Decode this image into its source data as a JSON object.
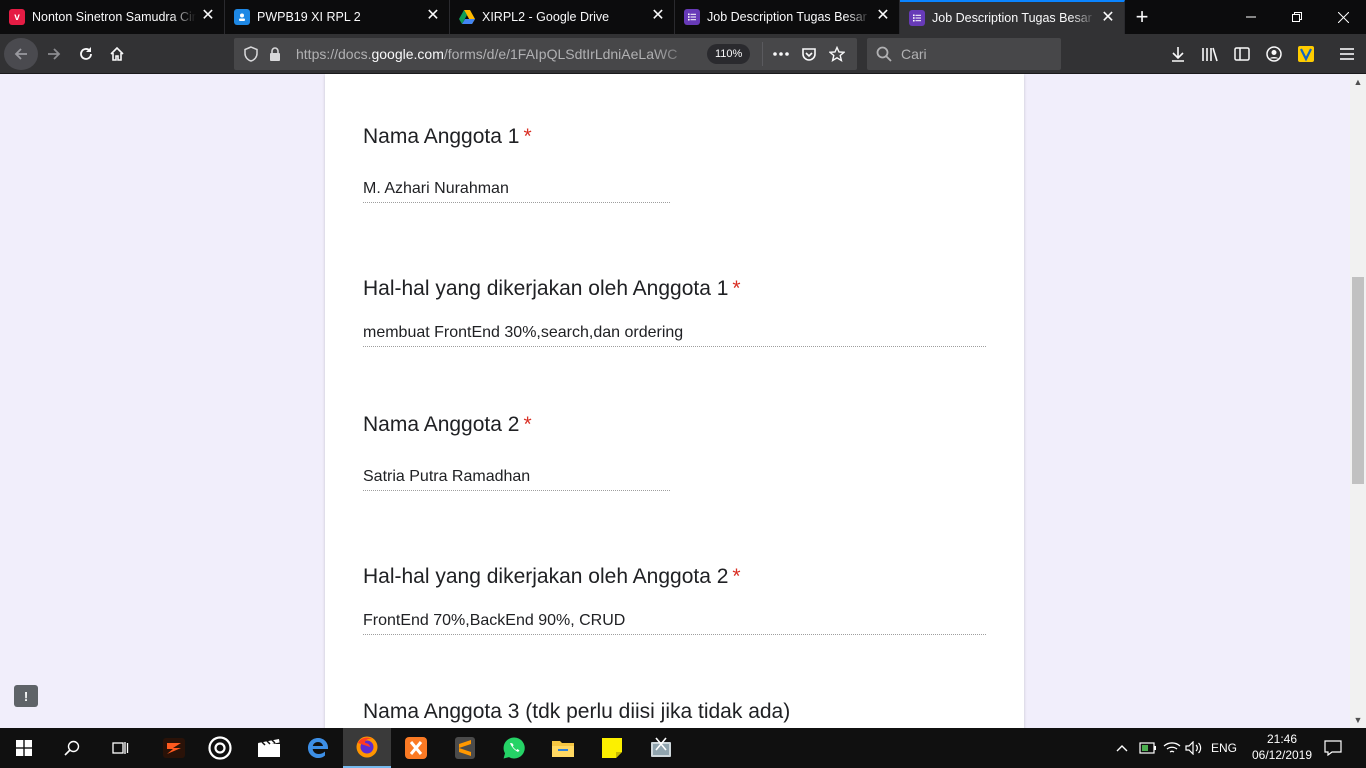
{
  "browser": {
    "tabs": [
      {
        "title": "Nonton Sinetron Samudra Cinta",
        "icon": "vidio-icon",
        "color": "#e51c44"
      },
      {
        "title": "PWPB19 XI RPL 2",
        "icon": "google-classroom-icon",
        "color": "#1e88e5"
      },
      {
        "title": "XIRPL2 - Google Drive",
        "icon": "google-drive-icon",
        "color": "#0f9d58"
      },
      {
        "title": "Job Description Tugas Besar ga",
        "icon": "google-forms-icon",
        "color": "#673ab7"
      },
      {
        "title": "Job Description Tugas Besar ga",
        "icon": "google-forms-icon",
        "color": "#673ab7"
      }
    ],
    "active_tab_index": 4,
    "url_prefix": "https://docs.",
    "url_domain": "google.com",
    "url_suffix": "/forms/d/e/1FAIpQLSdtIrLdniAeLaWC",
    "zoom": "110%",
    "search_placeholder": "Cari"
  },
  "form": {
    "questions": [
      {
        "title": "Nama Anggota 1",
        "required": "*",
        "answer": "M. Azhari Nurahman"
      },
      {
        "title": "Hal-hal yang dikerjakan oleh Anggota 1",
        "required": "*",
        "answer": "membuat FrontEnd 30%,search,dan ordering"
      },
      {
        "title": "Nama Anggota 2",
        "required": "*",
        "answer": "Satria Putra Ramadhan"
      },
      {
        "title": "Hal-hal yang dikerjakan oleh Anggota 2",
        "required": "*",
        "answer": "FrontEnd 70%,BackEnd 90%, CRUD"
      },
      {
        "title": "Nama Anggota 3 (tdk perlu diisi jika tidak ada)"
      }
    ],
    "feedback_icon": "!"
  },
  "taskbar": {
    "apps": [
      "start-icon",
      "search-icon",
      "task-view-icon",
      "game-app-icon",
      "media-icon",
      "movies-icon",
      "edge-icon",
      "firefox-icon",
      "xampp-icon",
      "sublime-icon",
      "whatsapp-icon",
      "file-explorer-icon",
      "sticky-notes-icon",
      "snipping-icon"
    ],
    "language": "ENG",
    "time": "21:46",
    "date": "06/12/2019"
  },
  "colors": {
    "required": "#d93025",
    "page_background": "#f1eefb",
    "active_tab_accent": "#0a84ff"
  }
}
